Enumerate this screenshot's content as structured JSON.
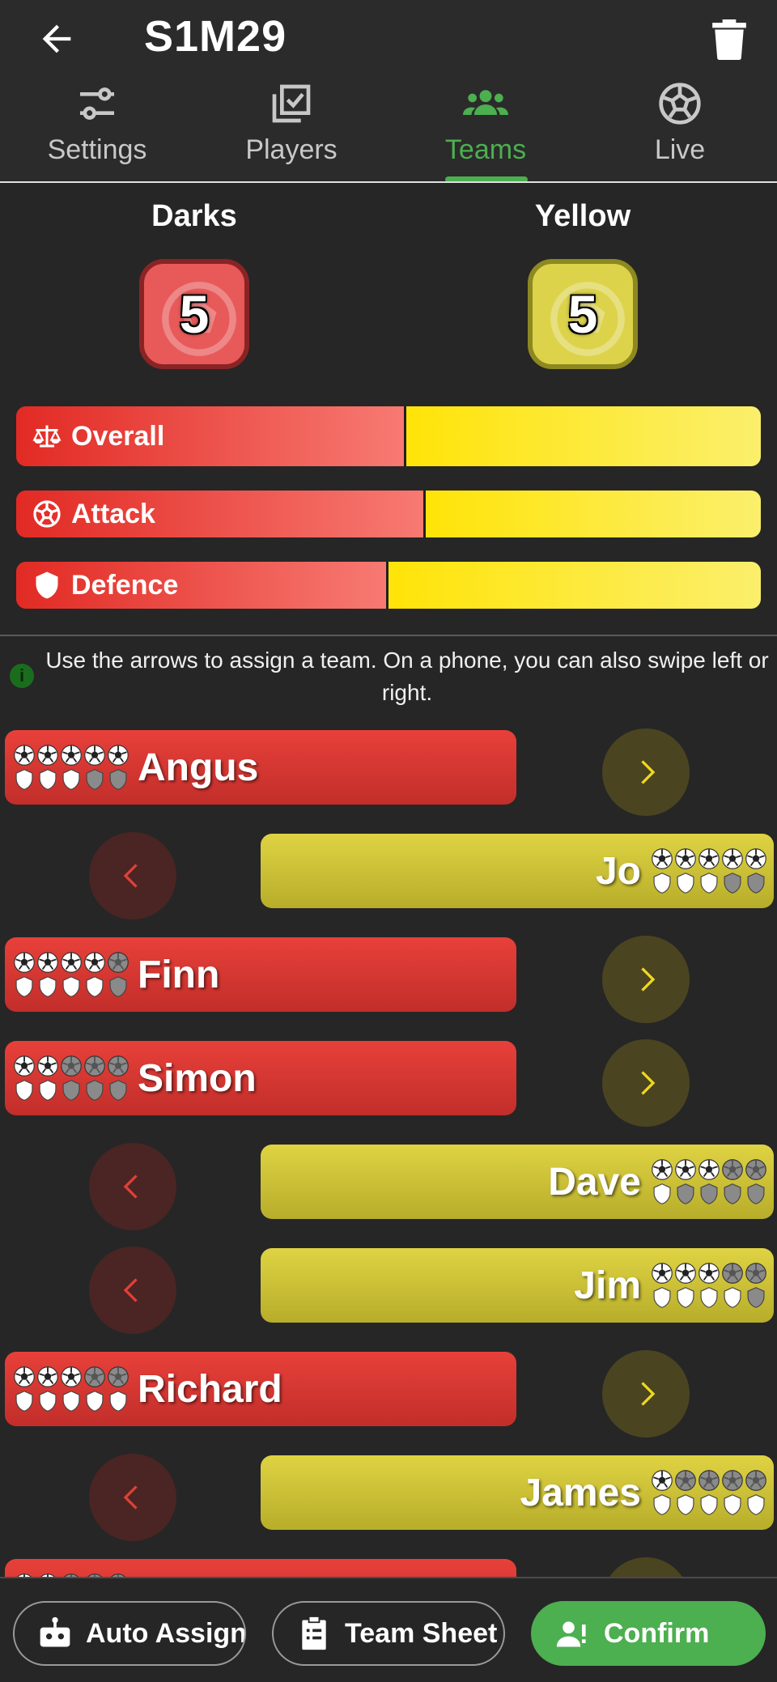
{
  "header": {
    "title": "S1M29",
    "back_icon": "arrow-left-icon",
    "delete_icon": "trash-icon"
  },
  "tabs": [
    {
      "label": "Settings",
      "icon": "sliders-icon",
      "active": false
    },
    {
      "label": "Players",
      "icon": "checklist-icon",
      "active": false
    },
    {
      "label": "Teams",
      "icon": "group-icon",
      "active": true
    },
    {
      "label": "Live",
      "icon": "soccer-ball-icon",
      "active": false
    }
  ],
  "teams": {
    "dark": {
      "name": "Darks",
      "count": "5",
      "color": "#e85a5a"
    },
    "yellow": {
      "name": "Yellow",
      "count": "5",
      "color": "#dcd34b"
    }
  },
  "balance": [
    {
      "label": "Overall",
      "icon": "scales-icon",
      "dark_share": 0.524
    },
    {
      "label": "Attack",
      "icon": "soccer-ball-icon",
      "dark_share": 0.55
    },
    {
      "label": "Defence",
      "icon": "shield-icon",
      "dark_share": 0.5
    }
  ],
  "info": {
    "text": "Use the arrows to assign a team. On a phone, you can also swipe left or right."
  },
  "players": [
    {
      "name": "Angus",
      "team": "dark",
      "attack": 5,
      "defence": 3
    },
    {
      "name": "Jo",
      "team": "yellow",
      "attack": 5,
      "defence": 3
    },
    {
      "name": "Finn",
      "team": "dark",
      "attack": 4,
      "defence": 4
    },
    {
      "name": "Simon",
      "team": "dark",
      "attack": 2,
      "defence": 2
    },
    {
      "name": "Dave",
      "team": "yellow",
      "attack": 3,
      "defence": 1
    },
    {
      "name": "Jim",
      "team": "yellow",
      "attack": 3,
      "defence": 4
    },
    {
      "name": "Richard",
      "team": "dark",
      "attack": 3,
      "defence": 5
    },
    {
      "name": "James",
      "team": "yellow",
      "attack": 1,
      "defence": 5
    },
    {
      "name": "",
      "team": "dark",
      "attack": 2,
      "defence": 0
    }
  ],
  "bottom": {
    "auto_assign": "Auto Assign",
    "team_sheet": "Team Sheet",
    "confirm": "Confirm"
  },
  "colors": {
    "accent": "#4caf50",
    "dark_team": "#e0403a",
    "yellow_team": "#d8cd3c"
  }
}
